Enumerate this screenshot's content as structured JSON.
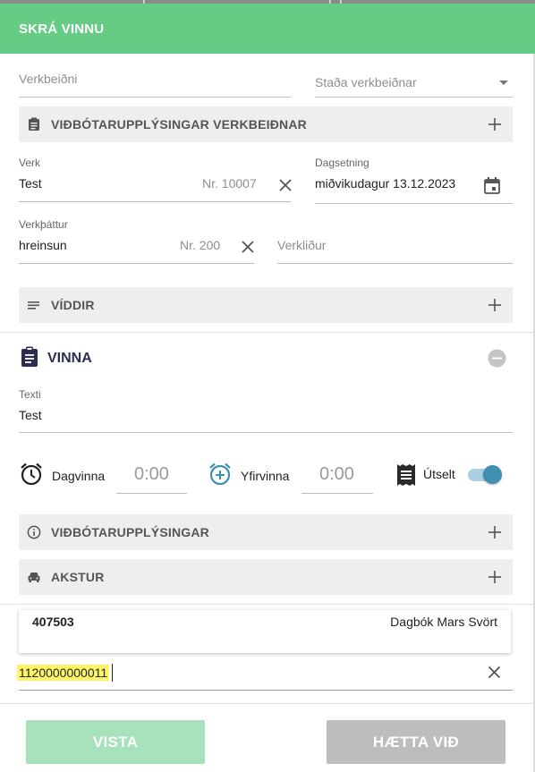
{
  "header": {
    "title": "SKRÁ VINNU"
  },
  "request": {
    "field_placeholder": "Verkbeiðni",
    "status_placeholder": "Staða verkbeiðnar"
  },
  "panels": {
    "request_info": "VIÐBÓTARUPPLÝSINGAR VERKBEIÐNAR",
    "dimensions": "VÍDDIR",
    "additional_info": "VIÐBÓTARUPPLÝSINGAR",
    "driving": "AKSTUR"
  },
  "job": {
    "label": "Verk",
    "value": "Test",
    "number": "Nr. 10007"
  },
  "date": {
    "label": "Dagsetning",
    "value": "miðvikudagur 13.12.2023"
  },
  "phase": {
    "label": "Verkþáttur",
    "value": "hreinsun",
    "number": "Nr. 200"
  },
  "component": {
    "placeholder": "Verkliður"
  },
  "work": {
    "title": "VINNA",
    "text_label": "Texti",
    "text_value": "Test",
    "daywork_label": "Dagvinna",
    "daywork_value": "0:00",
    "overtime_label": "Yfirvinna",
    "overtime_value": "0:00",
    "billed_label": "Útselt",
    "billed_on": true
  },
  "result_card": {
    "number": "407503",
    "description": "Dagbók Mars Svört"
  },
  "search": {
    "value": "1120000000011"
  },
  "buttons": {
    "save": "VISTA",
    "cancel": "HÆTTA VIÐ"
  },
  "colors": {
    "header": "#66cc85",
    "save_button": "#a8e2bd",
    "cancel_button": "#bdbdbd",
    "toggle": "#3f8fb0",
    "highlight": "#fff566"
  },
  "icons": {
    "request_info": "clipboard-icon",
    "dimensions": "lines-icon",
    "work": "clipboard-icon",
    "daywork": "alarm-clock-icon",
    "overtime": "alarm-add-icon",
    "billed": "receipt-icon",
    "additional_info": "info-icon",
    "driving": "car-icon"
  }
}
